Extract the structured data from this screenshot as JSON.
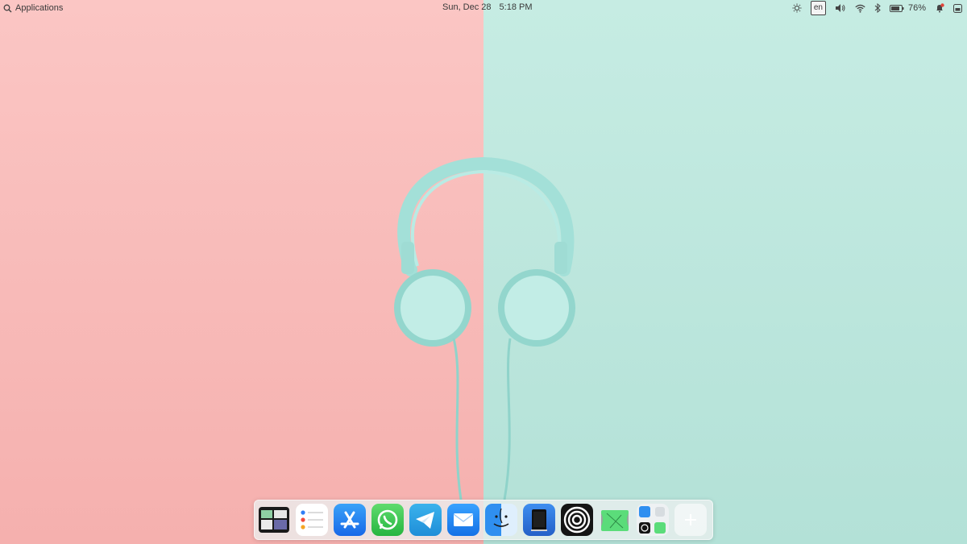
{
  "topbar": {
    "applications_label": "Applications",
    "date": "Sun, Dec 28",
    "time": "5:18 PM",
    "language": "en",
    "battery_percent": "76%"
  },
  "dock": {
    "items": [
      {
        "name": "multitasking-view",
        "icon": "multitasking-icon"
      },
      {
        "name": "reminders",
        "icon": "reminders-icon"
      },
      {
        "name": "app-store",
        "icon": "app-store-icon"
      },
      {
        "name": "whatsapp",
        "icon": "whatsapp-icon"
      },
      {
        "name": "telegram",
        "icon": "telegram-icon"
      },
      {
        "name": "mail",
        "icon": "mail-icon"
      },
      {
        "name": "files",
        "icon": "files-icon"
      },
      {
        "name": "sidecar",
        "icon": "tablet-icon"
      },
      {
        "name": "vinyl",
        "icon": "target-icon"
      },
      {
        "name": "map-app",
        "icon": "map-icon"
      },
      {
        "name": "app-folder",
        "icon": "folder-grid-icon"
      },
      {
        "name": "add",
        "icon": "plus-icon"
      }
    ]
  },
  "colors": {
    "wall_left": "#f9bebc",
    "wall_right": "#bfe8df",
    "headphones": "#a8e3dc"
  }
}
